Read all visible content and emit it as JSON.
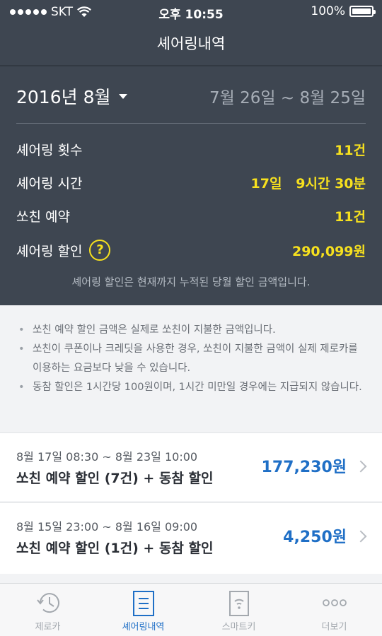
{
  "status_bar": {
    "carrier": "SKT",
    "time": "오후 10:55",
    "battery": "100%"
  },
  "nav": {
    "title": "셰어링내역"
  },
  "summary": {
    "month": "2016년 8월",
    "date_range": "7월 26일 ~ 8월 25일",
    "stats": [
      {
        "label": "셰어링 횟수",
        "value": "11건"
      },
      {
        "label": "셰어링 시간",
        "value": "17일   9시간 30분"
      },
      {
        "label": "쏘친 예약",
        "value": "11건"
      },
      {
        "label": "셰어링 할인",
        "value": "290,099원",
        "help_icon": "?"
      }
    ],
    "note": "셰어링 할인은 현재까지 누적된 당월 할인 금액입니다."
  },
  "notes": [
    "쏘친 예약 할인 금액은 실제로 쏘친이 지불한 금액입니다.",
    "쏘친이 쿠폰이나 크레딧을 사용한 경우, 쏘친이 지불한 금액이 실제 제로카를 이용하는 요금보다 낮을 수 있습니다.",
    "동참 할인은 1시간당 100원이며, 1시간 미만일 경우에는 지급되지 않습니다."
  ],
  "cards": [
    {
      "date": "8월 17일 08:30 ~ 8월 23일 10:00",
      "title": "쏘친 예약 할인 (7건) + 동참 할인",
      "amount": "177,230원"
    },
    {
      "date": "8월 15일 23:00 ~ 8월 16일 09:00",
      "title": "쏘친 예약 할인 (1건) + 동참 할인",
      "amount": "4,250원"
    }
  ],
  "tabs": [
    {
      "label": "제로카",
      "icon": "history-clock-icon",
      "active": false
    },
    {
      "label": "셰어링내역",
      "icon": "list-document-icon",
      "active": true
    },
    {
      "label": "스마트키",
      "icon": "smart-key-icon",
      "active": false
    },
    {
      "label": "더보기",
      "icon": "more-dots-icon",
      "active": false
    }
  ],
  "colors": {
    "header_bg": "#3e4651",
    "highlight_yellow": "#f7e11e",
    "accent_blue": "#1f6fc6"
  }
}
